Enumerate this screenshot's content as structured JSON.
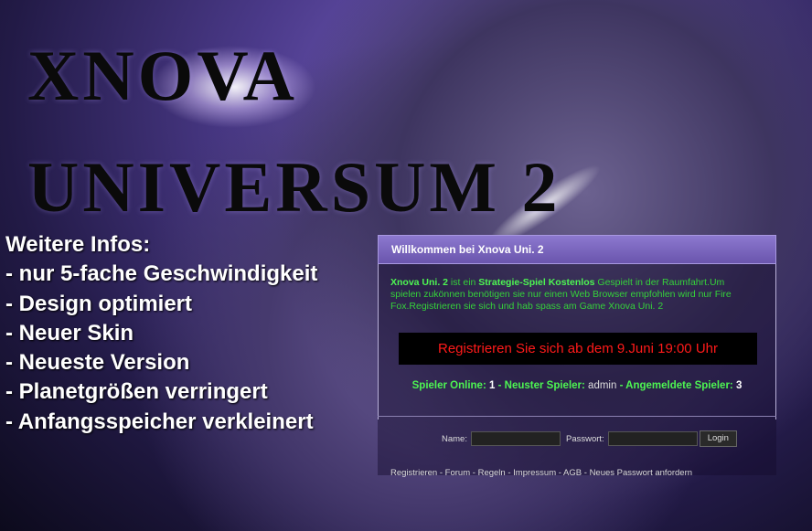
{
  "title": {
    "line1": "XNOVA",
    "line2": "UNIVERSUM 2"
  },
  "infos": {
    "heading": "Weitere Infos:",
    "items": [
      "- nur 5-fache Geschwindigkeit",
      "- Design optimiert",
      "- Neuer Skin",
      "- Neueste Version",
      "- Planetgrößen verringert",
      "- Anfangsspeicher verkleinert"
    ]
  },
  "panel": {
    "header": "Willkommen bei Xnova Uni. 2",
    "intro": {
      "name": "Xnova Uni. 2",
      "part1": " ist ein ",
      "highlight": "Strategie-Spiel Kostenlos",
      "part2": " Gespielt in der Raumfahrt.Um spielen zukönnen benötigen sie nur einen Web Browser empfohlen wird nur Fire Fox.Registrieren sie sich und hab spass am Game Xnova Uni. 2"
    },
    "register_notice": "Registrieren Sie sich ab dem 9.Juni 19:00 Uhr",
    "stats": {
      "online_label": "Spieler Online:",
      "online_value": "1",
      "sep": " - ",
      "newest_label": "Neuster Spieler:",
      "newest_value": "admin",
      "registered_label": "Angemeldete Spieler:",
      "registered_value": "3"
    },
    "login": {
      "name_label": "Name:",
      "password_label": "Passwort:",
      "button": "Login"
    },
    "links": [
      "Registrieren",
      "Forum",
      "Regeln",
      "Impressum",
      "AGB",
      "Neues Passwort anfordern"
    ],
    "link_separator": " - "
  }
}
